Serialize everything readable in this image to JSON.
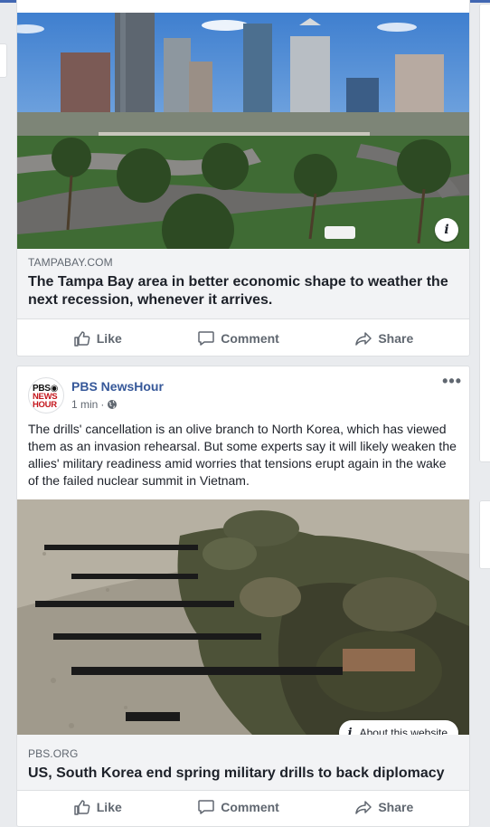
{
  "colors": {
    "page_bg": "#e9ebee",
    "brand_blue": "#4267b2",
    "link_name": "#365899",
    "muted": "#606770"
  },
  "post1": {
    "image_alt": "Tampa skyline with palm trees and highway",
    "domain": "TAMPABAY.COM",
    "headline": "The Tampa Bay area in better economic shape to weather the next recession, whenever it arrives.",
    "info_icon": "i",
    "actions": {
      "like": "Like",
      "comment": "Comment",
      "share": "Share"
    }
  },
  "post2": {
    "page_name": "PBS NewsHour",
    "avatar": {
      "line1": "PBS◉",
      "line2": "NEWS",
      "line3": "HOUR"
    },
    "time": "1 min",
    "separator": "·",
    "privacy_icon": "globe-icon",
    "more_icon": "•••",
    "text": "The drills' cancellation is an olive branch to North Korea, which has viewed them as an invasion rehearsal. But some experts say it will likely weaken the allies' military readiness amid worries that tensions erupt again in the wake of the failed nuclear summit in Vietnam.",
    "image_alt": "Marines aiming rifles while lying on sand",
    "about_label": "About this website",
    "about_icon": "i",
    "domain": "PBS.ORG",
    "headline": "US, South Korea end spring military drills to back diplomacy",
    "actions": {
      "like": "Like",
      "comment": "Comment",
      "share": "Share"
    }
  }
}
